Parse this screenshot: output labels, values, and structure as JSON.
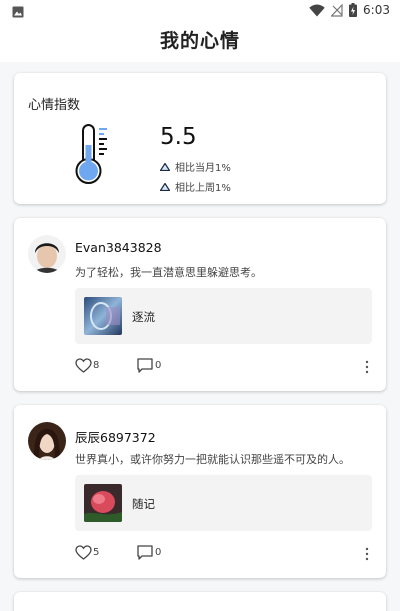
{
  "status_bar": {
    "time": "6:03",
    "icons": [
      "image-icon",
      "wifi-icon",
      "no-signal-icon",
      "battery-charging-icon"
    ]
  },
  "app_bar": {
    "title": "我的心情"
  },
  "mood_card": {
    "title": "心情指数",
    "score": "5.5",
    "icon": "thermometer-icon",
    "comparisons": [
      {
        "icon": "triangle-up-icon",
        "label": "相比当月1%"
      },
      {
        "icon": "triangle-up-icon",
        "label": "相比上周1%"
      }
    ]
  },
  "posts": [
    {
      "username": "Evan3843828",
      "text": "为了轻松，我一直潜意思里躲避思考。",
      "ref_label": "逐流",
      "likes": "8",
      "comments": "0"
    },
    {
      "username": "辰辰6897372",
      "text": "世界真小，或许你努力一把就能认识那些遥不可及的人。",
      "ref_label": "随记",
      "likes": "5",
      "comments": "0"
    }
  ],
  "colors": {
    "accent": "#6fa8f0",
    "background": "#f6f7f9",
    "card": "#ffffff"
  }
}
